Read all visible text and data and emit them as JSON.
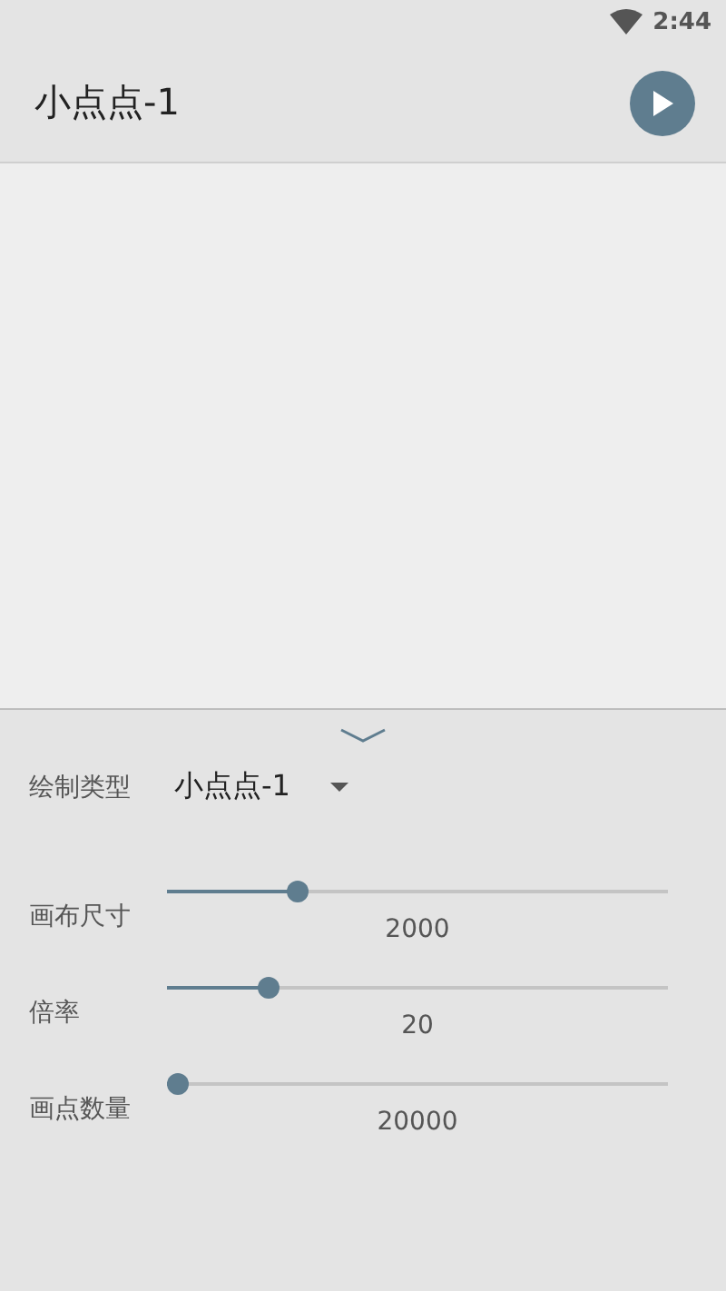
{
  "status_bar": {
    "time": "2:44"
  },
  "toolbar": {
    "title": "小点点-1"
  },
  "panel": {
    "type_label": "绘制类型",
    "type_value": "小点点-1",
    "sliders": [
      {
        "label": "画布尺寸",
        "level": 0.25,
        "reading": "2000"
      },
      {
        "label": "倍率",
        "level": 0.19,
        "reading": "20"
      },
      {
        "label": "画点数量",
        "level": 0,
        "reading": "20000"
      }
    ]
  }
}
